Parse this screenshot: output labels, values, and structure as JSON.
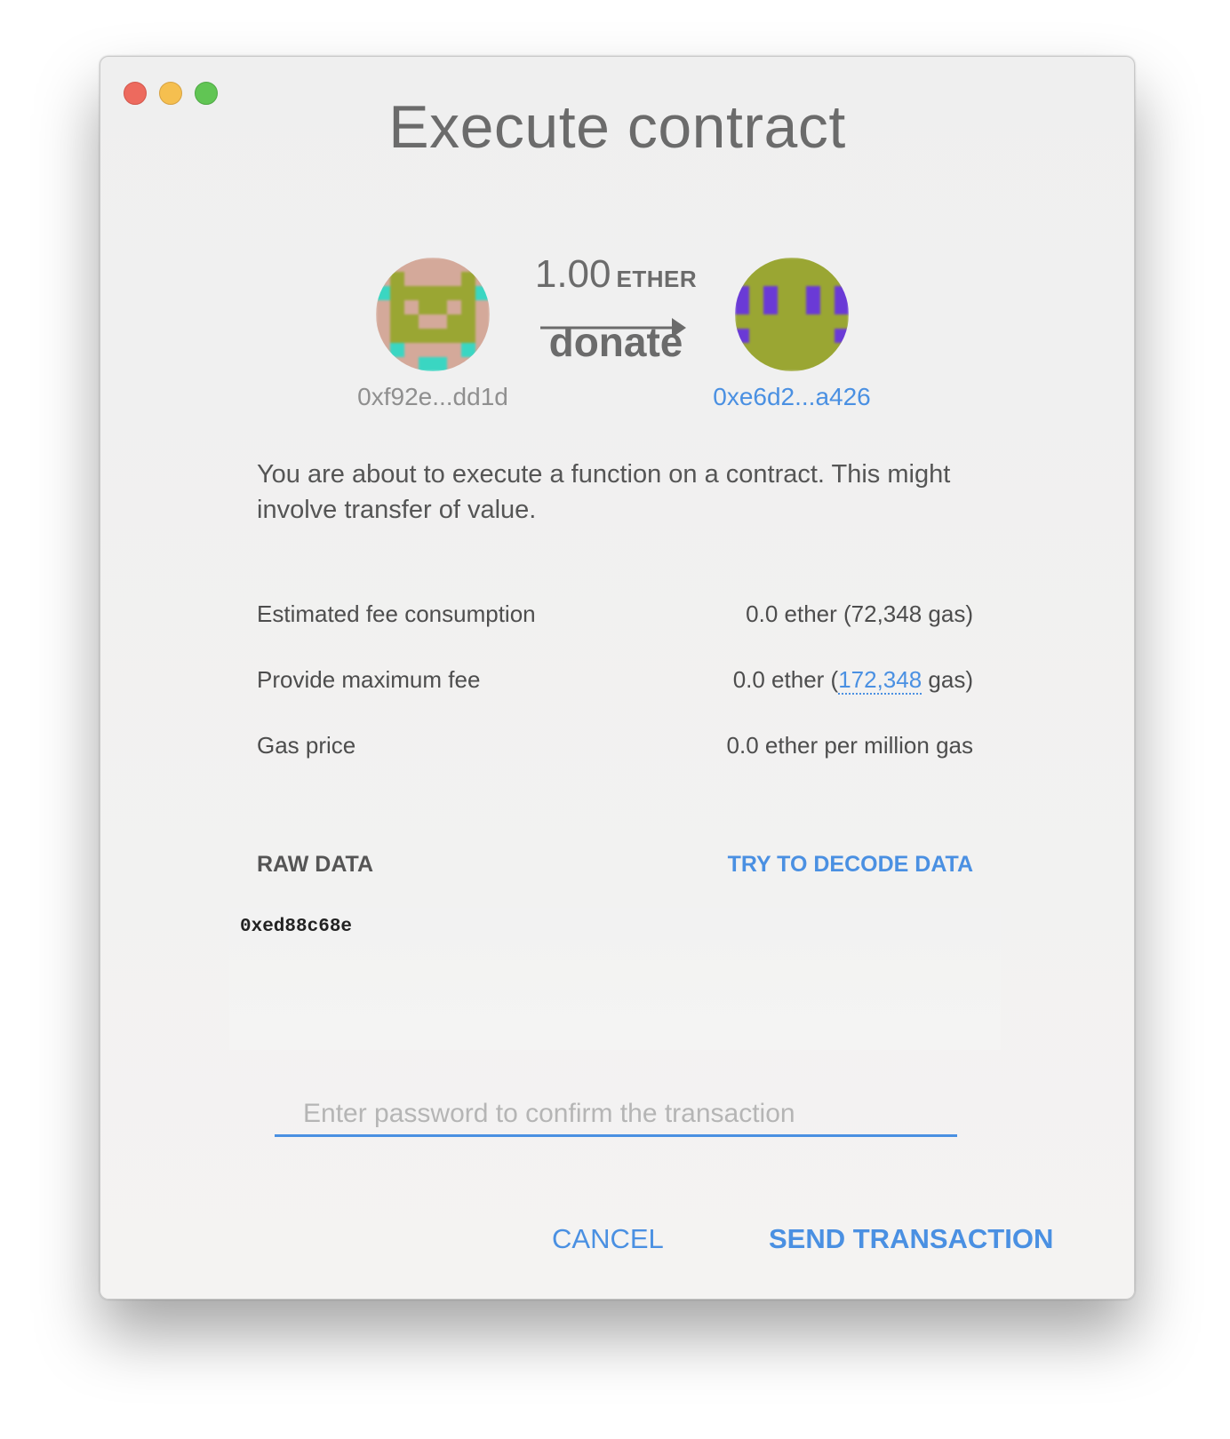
{
  "window": {
    "title": "Execute contract"
  },
  "transfer": {
    "amount": "1.00",
    "unit": "ETHER",
    "method": "donate",
    "from_address": "0xf92e...dd1d",
    "to_address": "0xe6d2...a426"
  },
  "description": "You are about to execute a function on a contract. This might involve transfer of value.",
  "fees": {
    "estimated_label": "Estimated fee consumption",
    "estimated_value": "0.0 ether (72,348 gas)",
    "max_label": "Provide maximum fee",
    "max_value_prefix": "0.0 ether (",
    "max_gas": "172,348",
    "max_value_suffix": " gas)",
    "gas_price_label": "Gas price",
    "gas_price_value": "0.0 ether per million gas"
  },
  "raw_data": {
    "label": "RAW DATA",
    "decode_link": "TRY TO DECODE DATA",
    "value": "0xed88c68e"
  },
  "password": {
    "placeholder": "Enter password to confirm the transaction",
    "value": ""
  },
  "buttons": {
    "cancel": "CANCEL",
    "send": "SEND TRANSACTION"
  },
  "colors": {
    "accent": "#4a90e2",
    "close": "#ed6a5e",
    "minimize": "#f5bf4f",
    "maximize": "#61c554",
    "from_identicon_bg": "#d4a99a",
    "from_identicon_fg": "#9aa633",
    "from_identicon_spot": "#3ad6c2",
    "to_identicon_bg": "#9aa633",
    "to_identicon_spot": "#6a3ad6"
  }
}
